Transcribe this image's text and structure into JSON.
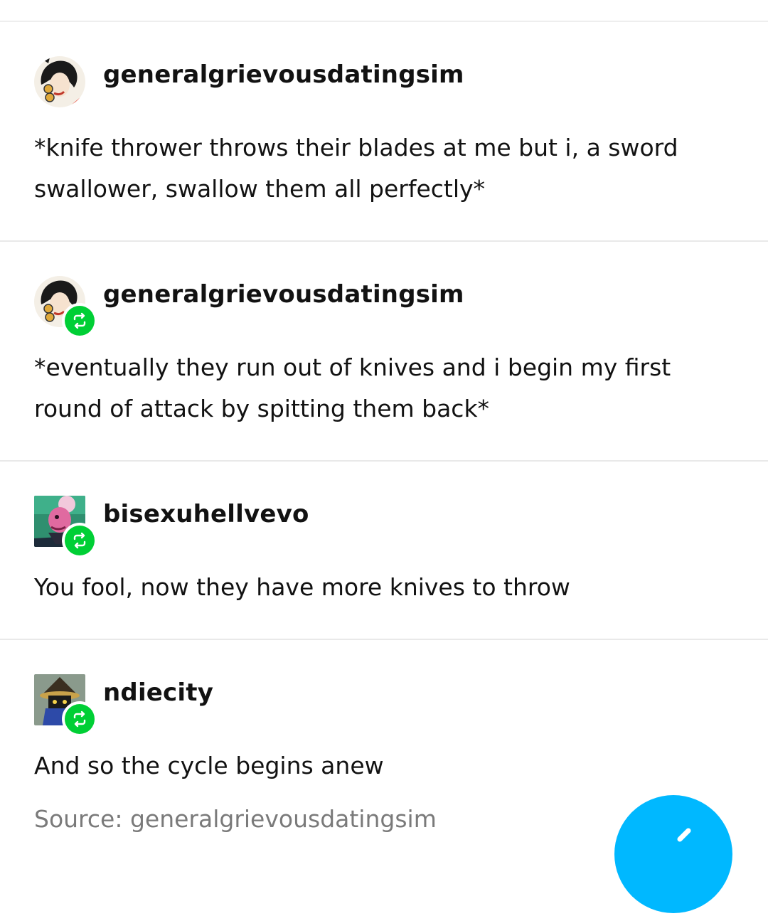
{
  "posts": [
    {
      "username": "generalgrievousdatingsim",
      "text": "*knife thrower throws their blades at me but i, a sword swallower, swallow them all perfectly*",
      "avatar_icon": "avatar-woman-telephone-icon",
      "reblog": false
    },
    {
      "username": "generalgrievousdatingsim",
      "text": "*eventually they run out of knives and i begin my first round of attack by spitting them back*",
      "avatar_icon": "avatar-woman-telephone-icon",
      "reblog": true
    },
    {
      "username": "bisexuhellvevo",
      "text": "You fool, now they have more knives to throw",
      "avatar_icon": "avatar-cartoon-character-icon",
      "reblog": true
    },
    {
      "username": "ndiecity",
      "text": "And so the cycle begins anew",
      "avatar_icon": "avatar-black-mage-icon",
      "reblog": true
    }
  ],
  "source": "Source: generalgrievousdatingsim",
  "colors": {
    "reblog_green": "#00cf35",
    "fab_blue": "#00b8ff",
    "source_gray": "#7a7a7a"
  }
}
